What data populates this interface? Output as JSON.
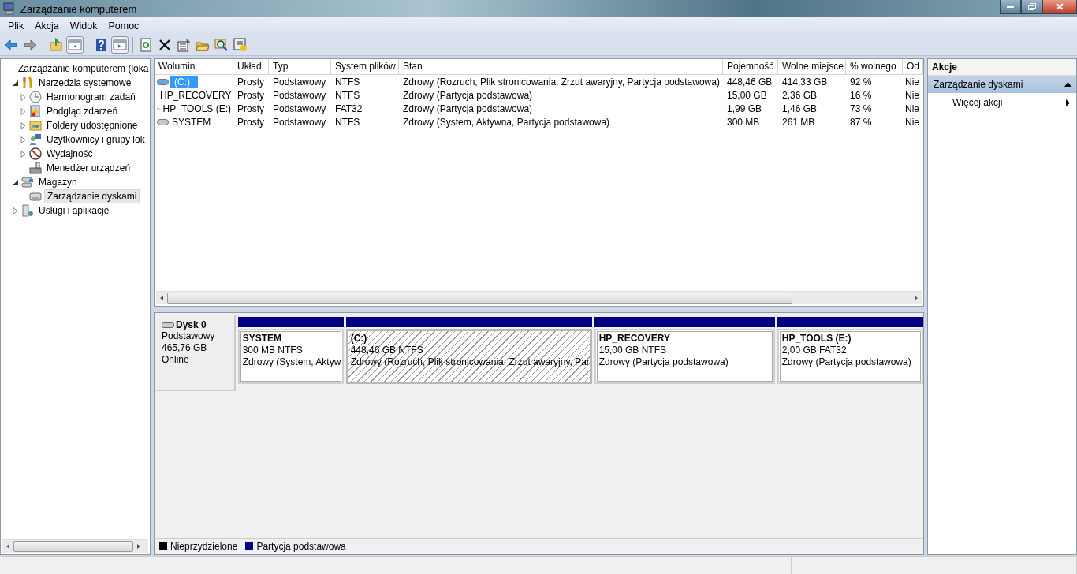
{
  "window": {
    "title": "Zarządzanie komputerem"
  },
  "menu": [
    "Plik",
    "Akcja",
    "Widok",
    "Pomoc"
  ],
  "tree": [
    {
      "label": "Zarządzanie komputerem (loka",
      "selected": false,
      "children": [
        {
          "label": "Narzędzia systemowe",
          "selected": false,
          "expanded": true,
          "children": [
            {
              "label": "Harmonogram zadań",
              "selected": false,
              "expanded": false
            },
            {
              "label": "Podgląd zdarzeń",
              "selected": false,
              "expanded": false
            },
            {
              "label": "Foldery udostępnione",
              "selected": false,
              "expanded": false
            },
            {
              "label": "Użytkownicy i grupy lok",
              "selected": false,
              "expanded": false
            },
            {
              "label": "Wydajność",
              "selected": false,
              "expanded": false
            },
            {
              "label": "Menedżer urządzeń",
              "selected": false
            }
          ]
        },
        {
          "label": "Magazyn",
          "selected": false,
          "expanded": true,
          "children": [
            {
              "label": "Zarządzanie dyskami",
              "selected": true
            }
          ]
        },
        {
          "label": "Usługi i aplikacje",
          "selected": false,
          "expanded": false
        }
      ]
    }
  ],
  "table": {
    "columns": [
      "Wolumin",
      "Układ",
      "Typ",
      "System plików",
      "Stan",
      "Pojemność",
      "Wolne miejsce",
      "% wolnego",
      "Od"
    ],
    "rows": [
      {
        "selected": true,
        "cells": [
          "(C:)",
          "Prosty",
          "Podstawowy",
          "NTFS",
          "Zdrowy (Rozruch, Plik stronicowania, Zrzut awaryjny, Partycja podstawowa)",
          "448,46 GB",
          "414,33 GB",
          "92 %",
          "Nie"
        ]
      },
      {
        "selected": false,
        "cells": [
          "HP_RECOVERY",
          "Prosty",
          "Podstawowy",
          "NTFS",
          "Zdrowy (Partycja podstawowa)",
          "15,00 GB",
          "2,36 GB",
          "16 %",
          "Nie"
        ]
      },
      {
        "selected": false,
        "cells": [
          "HP_TOOLS (E:)",
          "Prosty",
          "Podstawowy",
          "FAT32",
          "Zdrowy (Partycja podstawowa)",
          "1,99 GB",
          "1,46 GB",
          "73 %",
          "Nie"
        ]
      },
      {
        "selected": false,
        "cells": [
          "SYSTEM",
          "Prosty",
          "Podstawowy",
          "NTFS",
          "Zdrowy (System, Aktywna, Partycja podstawowa)",
          "300 MB",
          "261 MB",
          "87 %",
          "Nie"
        ]
      }
    ]
  },
  "disk": {
    "name": "Dysk 0",
    "type": "Podstawowy",
    "size": "465,76 GB",
    "status": "Online",
    "partitions": [
      {
        "name": "SYSTEM",
        "size": "300 MB NTFS",
        "status": "Zdrowy (System, Aktyw",
        "selected": false
      },
      {
        "name": "(C:)",
        "size": "448,46 GB NTFS",
        "status": "Zdrowy (Rozruch, Plik stronicowania, Zrzut awaryjny, Par",
        "selected": true
      },
      {
        "name": "HP_RECOVERY",
        "size": "15,00 GB NTFS",
        "status": "Zdrowy (Partycja podstawowa)",
        "selected": false
      },
      {
        "name": "HP_TOOLS  (E:)",
        "size": "2,00 GB FAT32",
        "status": "Zdrowy (Partycja podstawowa)",
        "selected": false
      }
    ]
  },
  "legend": [
    {
      "label": "Nieprzydzielone",
      "color": "#000000"
    },
    {
      "label": "Partycja podstawowa",
      "color": "#000080"
    }
  ],
  "actions": {
    "title": "Akcje",
    "section": {
      "label": "Zarządzanie dyskami",
      "expanded": true
    },
    "items": [
      "Więcej akcji"
    ]
  }
}
